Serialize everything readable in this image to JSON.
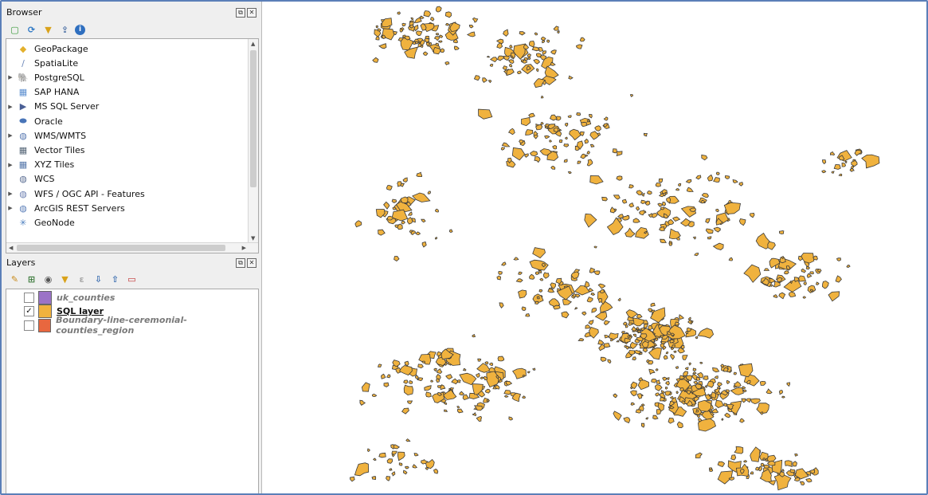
{
  "browser": {
    "title": "Browser",
    "toolbar": [
      {
        "icon": "add-selected-layers-icon"
      },
      {
        "icon": "refresh-icon"
      },
      {
        "icon": "filter-icon"
      },
      {
        "icon": "collapse-all-icon"
      },
      {
        "icon": "info-icon"
      }
    ],
    "items": [
      {
        "label": "GeoPackage",
        "icon": "geopackage-icon",
        "expandable": false,
        "color": "#e3b02c"
      },
      {
        "label": "SpatiaLite",
        "icon": "spatialite-icon",
        "expandable": false,
        "color": "#6b86b8"
      },
      {
        "label": "PostgreSQL",
        "icon": "postgresql-icon",
        "expandable": true,
        "color": "#3b6ea8"
      },
      {
        "label": "SAP HANA",
        "icon": "sap-hana-icon",
        "expandable": false,
        "color": "#5c8fd0"
      },
      {
        "label": "MS SQL Server",
        "icon": "mssql-icon",
        "expandable": true,
        "color": "#4a5f95"
      },
      {
        "label": "Oracle",
        "icon": "oracle-icon",
        "expandable": false,
        "color": "#4874b8"
      },
      {
        "label": "WMS/WMTS",
        "icon": "globe-icon",
        "expandable": true,
        "color": "#5778b0"
      },
      {
        "label": "Vector Tiles",
        "icon": "vector-tiles-icon",
        "expandable": false,
        "color": "#556677"
      },
      {
        "label": "XYZ Tiles",
        "icon": "xyz-tiles-icon",
        "expandable": true,
        "color": "#5577aa"
      },
      {
        "label": "WCS",
        "icon": "wcs-icon",
        "expandable": false,
        "color": "#5b6e93"
      },
      {
        "label": "WFS / OGC API - Features",
        "icon": "wfs-icon",
        "expandable": true,
        "color": "#6b7fb0"
      },
      {
        "label": "ArcGIS REST Servers",
        "icon": "arcgis-icon",
        "expandable": true,
        "color": "#5b7eb8"
      },
      {
        "label": "GeoNode",
        "icon": "geonode-icon",
        "expandable": false,
        "color": "#4d7fbf"
      }
    ]
  },
  "layers": {
    "title": "Layers",
    "toolbar": [
      {
        "icon": "style-icon"
      },
      {
        "icon": "add-group-icon"
      },
      {
        "icon": "visibility-icon"
      },
      {
        "icon": "filter-legend-icon"
      },
      {
        "icon": "expression-filter-icon"
      },
      {
        "icon": "expand-all-icon"
      },
      {
        "icon": "collapse-all-icon"
      },
      {
        "icon": "remove-layer-icon"
      }
    ],
    "items": [
      {
        "label": "uk_counties",
        "checked": false,
        "italic": true,
        "bold": true,
        "underline": false,
        "swatch": "#9b73c7",
        "muted": true
      },
      {
        "label": "SQL layer",
        "checked": true,
        "italic": false,
        "bold": true,
        "underline": true,
        "swatch": "#f0b23e",
        "muted": false
      },
      {
        "label": "Boundary-line-ceremonial-counties_region",
        "checked": false,
        "italic": true,
        "bold": true,
        "underline": false,
        "swatch": "#e8673f",
        "muted": true
      }
    ]
  },
  "map": {
    "fill_color": "#f0b23e",
    "stroke_color": "#3a3a3a",
    "background": "#ffffff"
  }
}
